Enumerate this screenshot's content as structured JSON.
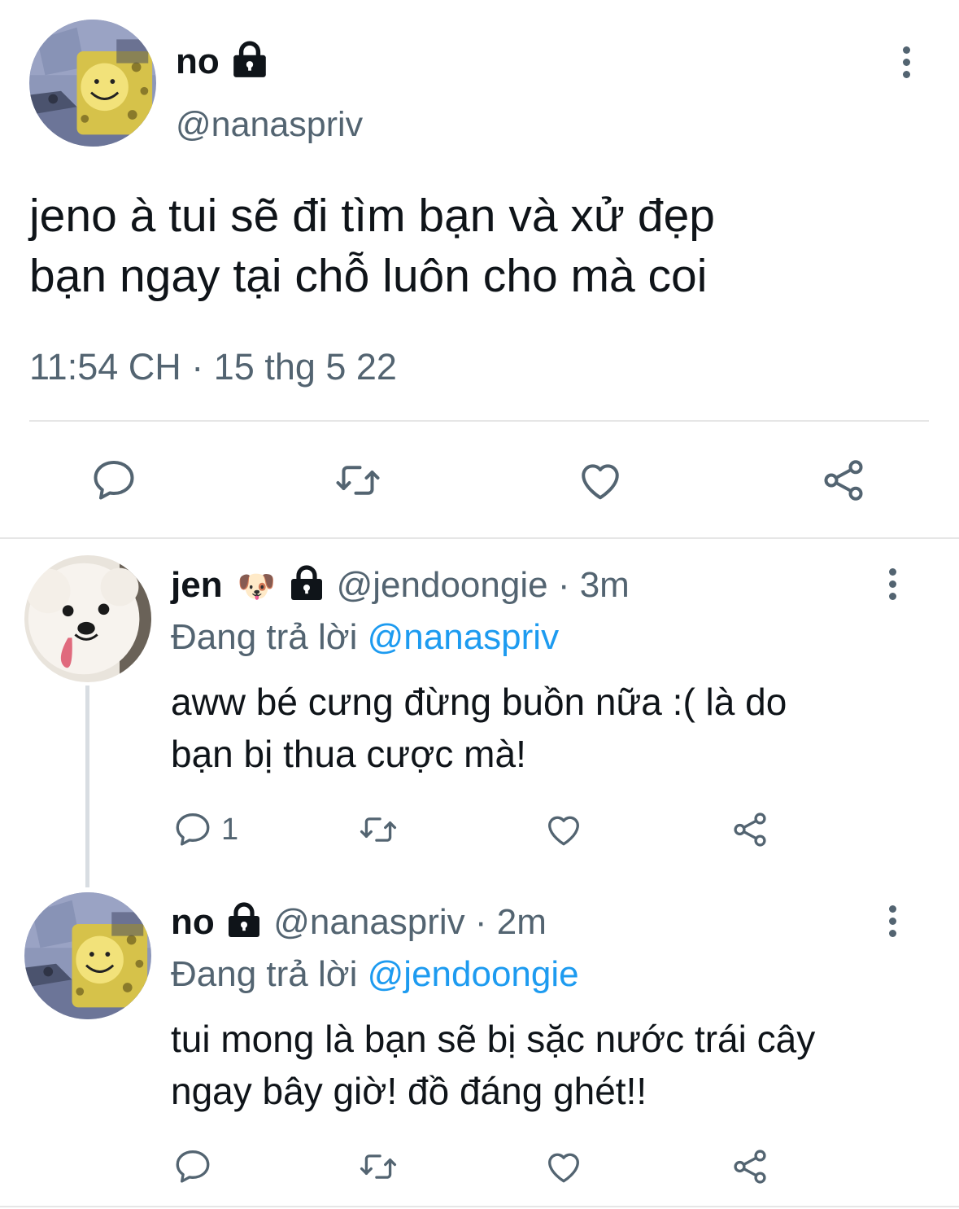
{
  "main_tweet": {
    "display_name": "no",
    "handle": "@nanaspriv",
    "text_line1": "jeno à tui sẽ đi tìm bạn và xử đẹp",
    "text_line2": "bạn ngay tại chỗ luôn cho mà coi",
    "timestamp": "11:54 CH · 15 thg 5 22",
    "avatar_icon": "spongebob-avatar",
    "locked": true
  },
  "replies": [
    {
      "display_name": "jen",
      "emoji": "🐶",
      "handle": "@jendoongie",
      "time": "3m",
      "replying_label": "Đang trả lời",
      "replying_to": "@nanaspriv",
      "text_line1": "aww bé cưng đừng buồn nữa :( là do",
      "text_line2": "bạn bị thua cược mà!",
      "reply_count": "1",
      "avatar_icon": "samoyed-dog-avatar",
      "locked": true
    },
    {
      "display_name": "no",
      "handle": "@nanaspriv",
      "time": "2m",
      "replying_label": "Đang trả lời",
      "replying_to": "@jendoongie",
      "text_line1": "tui mong là bạn sẽ bị sặc nước trái cây",
      "text_line2": "ngay bây giờ! đồ đáng ghét!!",
      "reply_count": "",
      "avatar_icon": "spongebob-avatar",
      "locked": true
    }
  ],
  "separator": " · ",
  "colors": {
    "accent": "#1d9bf0",
    "secondary_text": "#536471",
    "primary_text": "#0f1419",
    "divider": "#e6e6e6"
  }
}
